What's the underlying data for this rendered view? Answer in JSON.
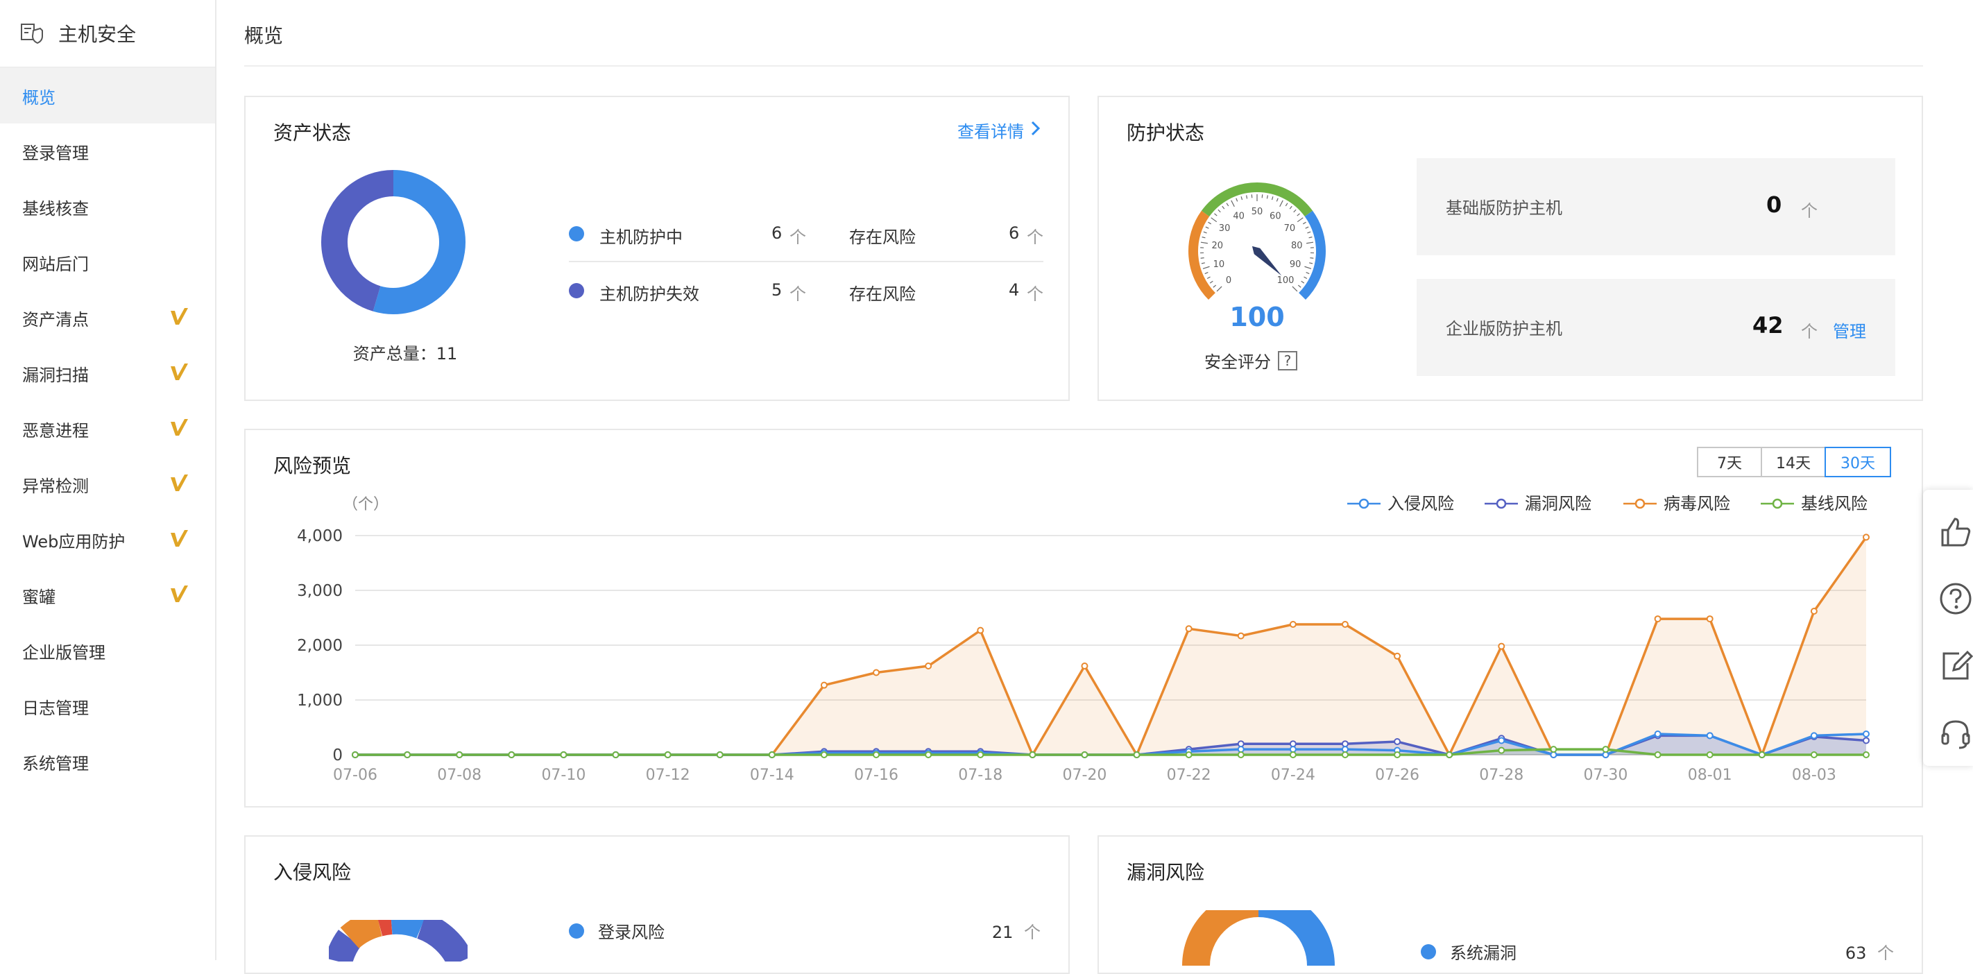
{
  "sidebar": {
    "title": "主机安全",
    "items": [
      {
        "label": "概览",
        "active": true,
        "vip": false
      },
      {
        "label": "登录管理",
        "active": false,
        "vip": false
      },
      {
        "label": "基线核查",
        "active": false,
        "vip": false
      },
      {
        "label": "网站后门",
        "active": false,
        "vip": false
      },
      {
        "label": "资产清点",
        "active": false,
        "vip": true
      },
      {
        "label": "漏洞扫描",
        "active": false,
        "vip": true
      },
      {
        "label": "恶意进程",
        "active": false,
        "vip": true
      },
      {
        "label": "异常检测",
        "active": false,
        "vip": true
      },
      {
        "label": "Web应用防护",
        "active": false,
        "vip": true
      },
      {
        "label": "蜜罐",
        "active": false,
        "vip": true
      },
      {
        "label": "企业版管理",
        "active": false,
        "vip": false
      },
      {
        "label": "日志管理",
        "active": false,
        "vip": false
      },
      {
        "label": "系统管理",
        "active": false,
        "vip": false
      }
    ]
  },
  "page_title": "概览",
  "asset_status": {
    "title": "资产状态",
    "detail_link": "查看详情",
    "total_label": "资产总量：11",
    "rows": [
      {
        "name": "主机防护中",
        "count": "6",
        "unit": "个",
        "risk_label": "存在风险",
        "risk_count": "6",
        "risk_unit": "个",
        "color": "#3c8ce7"
      },
      {
        "name": "主机防护失效",
        "count": "5",
        "unit": "个",
        "risk_label": "存在风险",
        "risk_count": "4",
        "risk_unit": "个",
        "color": "#5460c2"
      }
    ],
    "donut": [
      {
        "value": 6,
        "color": "#3c8ce7"
      },
      {
        "value": 5,
        "color": "#5460c2"
      }
    ]
  },
  "protection_status": {
    "title": "防护状态",
    "gauge_value": "100",
    "gauge_ticks": [
      "0",
      "10",
      "20",
      "30",
      "40",
      "50",
      "60",
      "70",
      "80",
      "90",
      "100"
    ],
    "score_label": "安全评分",
    "help": "?",
    "basic": {
      "label": "基础版防护主机",
      "count": "0",
      "unit": "个"
    },
    "enterprise": {
      "label": "企业版防护主机",
      "count": "42",
      "unit": "个",
      "manage": "管理"
    }
  },
  "risk_overview": {
    "title": "风险预览",
    "tabs": [
      {
        "label": "7天",
        "active": false
      },
      {
        "label": "14天",
        "active": false
      },
      {
        "label": "30天",
        "active": true
      }
    ],
    "unit_label": "（个）"
  },
  "chart_data": {
    "type": "line",
    "x": [
      "07-06",
      "07-07",
      "07-08",
      "07-09",
      "07-10",
      "07-11",
      "07-12",
      "07-13",
      "07-14",
      "07-15",
      "07-16",
      "07-17",
      "07-18",
      "07-19",
      "07-20",
      "07-21",
      "07-22",
      "07-23",
      "07-24",
      "07-25",
      "07-26",
      "07-27",
      "07-28",
      "07-29",
      "07-30",
      "07-31",
      "08-01",
      "08-02",
      "08-03",
      "08-04"
    ],
    "xticks": [
      "07-06",
      "07-08",
      "07-10",
      "07-12",
      "07-14",
      "07-16",
      "07-18",
      "07-20",
      "07-22",
      "07-24",
      "07-26",
      "07-28",
      "07-30",
      "08-01",
      "08-03"
    ],
    "yticks": [
      "0",
      "1,000",
      "2,000",
      "3,000",
      "4,000"
    ],
    "ylim": [
      0,
      4000
    ],
    "legend_position": "top-right",
    "grid": true,
    "series": [
      {
        "name": "入侵风险",
        "color": "#3c8ce7",
        "values": [
          0,
          0,
          0,
          0,
          0,
          0,
          0,
          0,
          0,
          30,
          30,
          30,
          30,
          0,
          0,
          0,
          60,
          100,
          100,
          100,
          80,
          0,
          260,
          0,
          0,
          380,
          350,
          0,
          350,
          380
        ]
      },
      {
        "name": "漏洞风险",
        "color": "#5460c2",
        "values": [
          0,
          0,
          0,
          0,
          0,
          0,
          0,
          0,
          0,
          60,
          60,
          60,
          60,
          0,
          0,
          0,
          100,
          200,
          200,
          200,
          240,
          0,
          300,
          0,
          0,
          350,
          350,
          0,
          330,
          260
        ]
      },
      {
        "name": "病毒风险",
        "color": "#e8892f",
        "values": [
          0,
          0,
          0,
          0,
          0,
          0,
          0,
          0,
          0,
          1270,
          1500,
          1620,
          2270,
          0,
          1620,
          0,
          2300,
          2170,
          2380,
          2380,
          1800,
          0,
          1980,
          0,
          0,
          2480,
          2480,
          0,
          2620,
          3970
        ]
      },
      {
        "name": "基线风险",
        "color": "#6fb344",
        "values": [
          0,
          0,
          0,
          0,
          0,
          0,
          0,
          0,
          0,
          0,
          0,
          0,
          0,
          0,
          0,
          0,
          0,
          0,
          0,
          0,
          0,
          0,
          80,
          100,
          100,
          0,
          0,
          0,
          0,
          0
        ]
      }
    ]
  },
  "intrusion_risk": {
    "title": "入侵风险",
    "first_item": {
      "name": "登录风险",
      "count": "21",
      "unit": "个",
      "color": "#3c8ce7"
    }
  },
  "vuln_risk": {
    "title": "漏洞风险",
    "first_item": {
      "name": "系统漏洞",
      "count": "63",
      "unit": "个",
      "color": "#3c8ce7"
    }
  }
}
